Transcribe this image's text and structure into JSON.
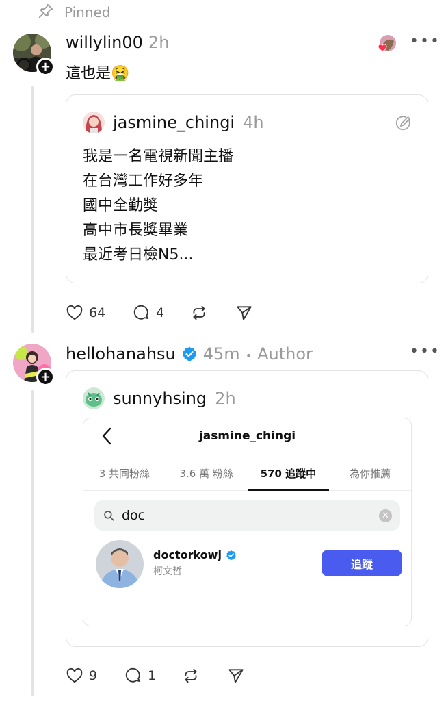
{
  "pinned_label": "Pinned",
  "post1": {
    "username": "willylin00",
    "time": "2h",
    "text": "這也是",
    "emoji": "🤮",
    "quote": {
      "username": "jasmine_chingi",
      "time": "4h",
      "lines": [
        "我是一名電視新聞主播",
        "在台灣工作好多年",
        "國中全勤獎",
        "高中市長獎畢業",
        "最近考日檢N5..."
      ]
    },
    "likes": "64",
    "replies": "4"
  },
  "post2": {
    "username": "hellohanahsu",
    "time": "45m",
    "separator": "•",
    "author_label": "Author",
    "quote": {
      "username": "sunnyhsing",
      "time": "2h",
      "screenshot": {
        "title": "jasmine_chingi",
        "tabs": [
          "3 共同粉絲",
          "3.6 萬 粉絲",
          "570 追蹤中",
          "為你推薦"
        ],
        "search_value": "doc",
        "result": {
          "username": "doctorkowj",
          "display_name": "柯文哲",
          "follow_label": "追蹤"
        }
      }
    },
    "likes": "9",
    "replies": "1"
  },
  "colors": {
    "verified": "#1d9bf0",
    "follow_button": "#4a5cf0",
    "muted_text": "#9a9a9a",
    "border": "#e3e3e3"
  }
}
